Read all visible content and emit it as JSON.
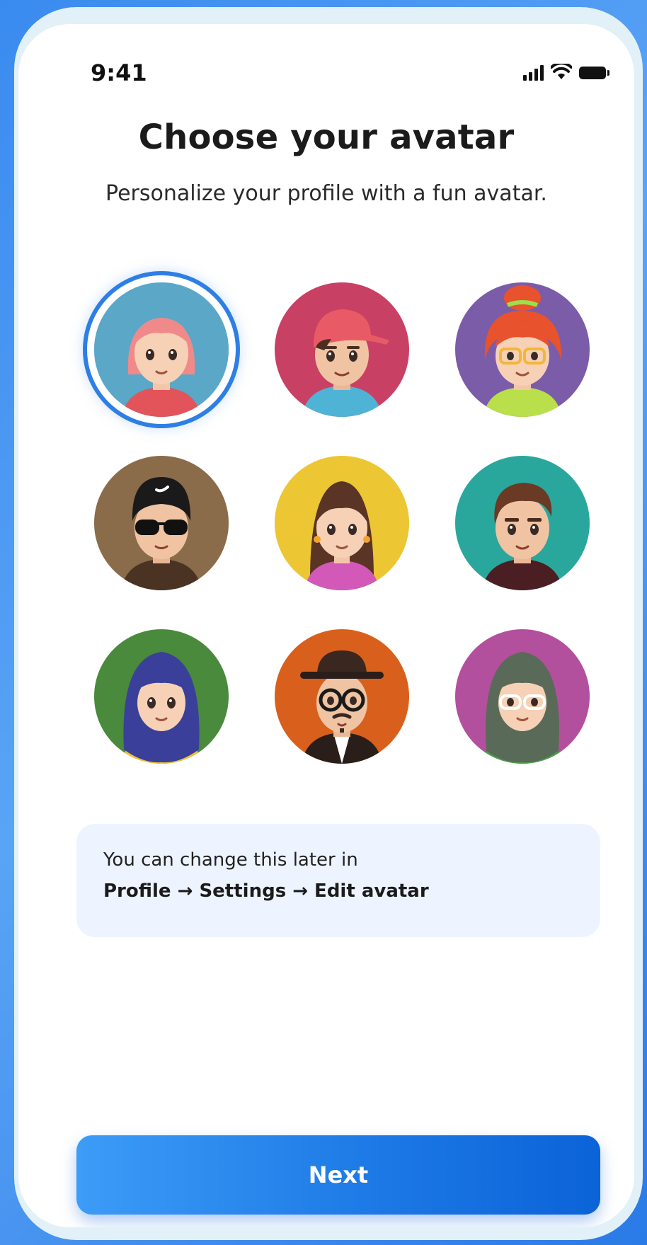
{
  "status_bar": {
    "time": "9:41",
    "icons": [
      "signal-icon",
      "wifi-icon",
      "battery-icon"
    ]
  },
  "header": {
    "title": "Choose your avatar",
    "subtitle": "Personalize your profile with a fun avatar."
  },
  "avatars": {
    "selected_index": 0,
    "items": [
      {
        "name": "pink-hair-girl",
        "bg": "#5aa7c8"
      },
      {
        "name": "red-cap-boy",
        "bg": "#c94065"
      },
      {
        "name": "redhead-glasses-girl",
        "bg": "#7b5ca8"
      },
      {
        "name": "sunglasses-man",
        "bg": "#8a6b4a"
      },
      {
        "name": "brunette-woman",
        "bg": "#ecc633"
      },
      {
        "name": "brown-hair-man",
        "bg": "#2aa79c"
      },
      {
        "name": "blue-hijab-woman",
        "bg": "#4a8a3c"
      },
      {
        "name": "hat-glasses-man",
        "bg": "#d8601c"
      },
      {
        "name": "gray-hijab-woman",
        "bg": "#b2509e"
      }
    ]
  },
  "info": {
    "line1": "You can change this later in",
    "line2": "Profile → Settings → Edit avatar"
  },
  "next_button": {
    "label": "Next"
  },
  "colors": {
    "accent": "#2d7fe6",
    "info_bg": "#eef4ff"
  }
}
